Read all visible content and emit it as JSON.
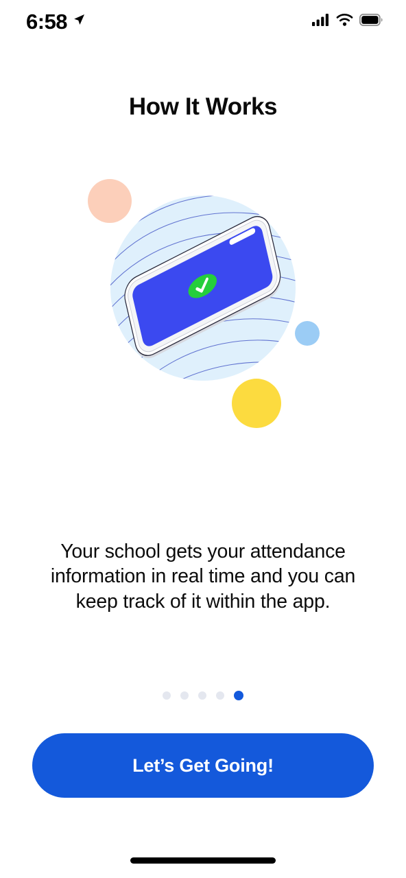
{
  "status_bar": {
    "time": "6:58",
    "location_icon": "location-arrow-icon",
    "cellular_icon": "cellular-signal-icon",
    "wifi_icon": "wifi-icon",
    "battery_icon": "battery-full-icon"
  },
  "header": {
    "title": "How It Works"
  },
  "illustration": {
    "name": "phone-attendance-illustration",
    "backdrop_circle_color": "#DFF0FC",
    "wave_line_color": "#4A5CC8",
    "phone_screen_color": "#3B49F0",
    "phone_body_color": "#F4F5F7",
    "badge_color": "#25CE3C",
    "badge_icon": "check-icon",
    "accent_circles": [
      {
        "name": "peach-circle",
        "color": "#FCCFBA"
      },
      {
        "name": "light-blue-circle",
        "color": "#9BCCF5"
      },
      {
        "name": "yellow-circle",
        "color": "#FCDB3F"
      }
    ]
  },
  "main": {
    "body_text": "Your school gets your attendance information in real time and you can keep track of it within the app."
  },
  "pagination": {
    "total": 5,
    "active_index": 5,
    "inactive_color": "#E4E7EF",
    "active_color": "#1359DC"
  },
  "cta": {
    "label": "Let’s Get Going!",
    "color": "#1459DB"
  },
  "home_indicator": {
    "name": "home-indicator"
  }
}
